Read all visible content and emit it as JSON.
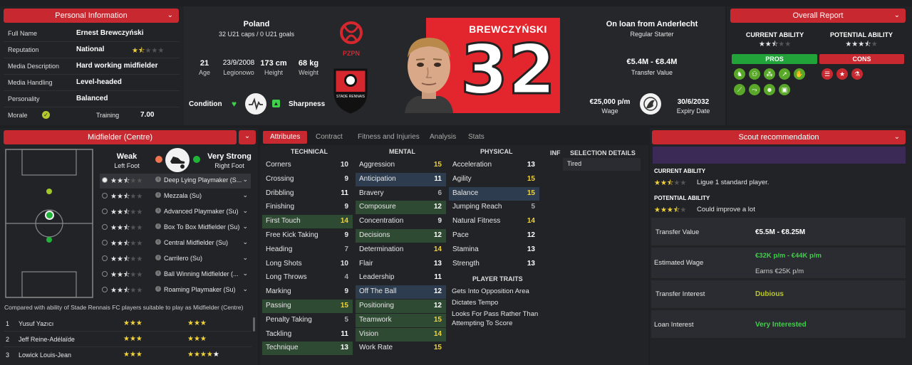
{
  "personal": {
    "header": "Personal Information",
    "rows": [
      {
        "label": "Full Name",
        "value": "Ernest Brewczyński"
      },
      {
        "label": "Reputation",
        "value": "National"
      },
      {
        "label": "Media Description",
        "value": "Hard working midfielder"
      },
      {
        "label": "Media Handling",
        "value": "Level-headed"
      },
      {
        "label": "Personality",
        "value": "Balanced"
      }
    ],
    "morale_label": "Morale",
    "training_label": "Training",
    "training_value": "7.00"
  },
  "profile": {
    "nation": "Poland",
    "caps": "32 U21 caps / 0 U21 goals",
    "age": "21",
    "age_label": "Age",
    "dob": "23/9/2008",
    "dob_label": "Legionowo",
    "height": "173 cm",
    "height_label": "Height",
    "weight": "68 kg",
    "weight_label": "Weight",
    "condition_label": "Condition",
    "sharpness_label": "Sharpness",
    "nation_badge_text": "PZPN",
    "club_badge_text": "STADE RENNAIS",
    "shirt_name": "BREWCZYŃSKI",
    "shirt_number": "32"
  },
  "contract": {
    "loan": "On loan from Anderlecht",
    "status": "Regular Starter",
    "value": "€5.4M - €8.4M",
    "value_label": "Transfer Value",
    "wage": "€25,000 p/m",
    "wage_label": "Wage",
    "expiry": "30/6/2032",
    "expiry_label": "Expiry Date"
  },
  "overall": {
    "header": "Overall Report",
    "current_label": "CURRENT ABILITY",
    "potential_label": "POTENTIAL ABILITY",
    "current_stars": 2.5,
    "potential_stars": 3.5,
    "pros_label": "PROS",
    "cons_label": "CONS"
  },
  "position": {
    "header": "Midfielder (Centre)",
    "weak_label": "Weak",
    "weak_foot": "Left Foot",
    "strong_label": "Very Strong",
    "strong_foot": "Right Foot",
    "roles": [
      {
        "name": "Deep Lying Playmaker (S...",
        "stars": 2.5
      },
      {
        "name": "Mezzala (Su)",
        "stars": 2.5
      },
      {
        "name": "Advanced Playmaker (Su)",
        "stars": 2.5
      },
      {
        "name": "Box To Box Midfielder (Su)",
        "stars": 2.5
      },
      {
        "name": "Central Midfielder (Su)",
        "stars": 2.5
      },
      {
        "name": "Carrilero (Su)",
        "stars": 2.5
      },
      {
        "name": "Ball Winning Midfielder (...",
        "stars": 2.5
      },
      {
        "name": "Roaming Playmaker (Su)",
        "stars": 2.5
      }
    ],
    "compare_text": "Compared with ability of Stade Rennais FC players suitable to play as Midfielder (Centre)",
    "compare": [
      {
        "rank": "1",
        "name": "Yusuf Yazıcı"
      },
      {
        "rank": "2",
        "name": "Jeff Reine-Adélaïde"
      },
      {
        "rank": "3",
        "name": "Lowick Louis-Jean"
      }
    ]
  },
  "tabs": [
    "Attributes",
    "Contract",
    "Fitness and Injuries",
    "Analysis",
    "Stats"
  ],
  "attributes": {
    "technical_label": "TECHNICAL",
    "mental_label": "MENTAL",
    "physical_label": "PHYSICAL",
    "inf_label": "INF",
    "selection_label": "SELECTION DETAILS",
    "selection_value": "Tired",
    "traits_label": "PLAYER TRAITS",
    "technical": [
      {
        "name": "Corners",
        "value": "10"
      },
      {
        "name": "Crossing",
        "value": "9"
      },
      {
        "name": "Dribbling",
        "value": "11"
      },
      {
        "name": "Finishing",
        "value": "9"
      },
      {
        "name": "First Touch",
        "value": "14"
      },
      {
        "name": "Free Kick Taking",
        "value": "9"
      },
      {
        "name": "Heading",
        "value": "7"
      },
      {
        "name": "Long Shots",
        "value": "10"
      },
      {
        "name": "Long Throws",
        "value": "4"
      },
      {
        "name": "Marking",
        "value": "9"
      },
      {
        "name": "Passing",
        "value": "15"
      },
      {
        "name": "Penalty Taking",
        "value": "5"
      },
      {
        "name": "Tackling",
        "value": "11"
      },
      {
        "name": "Technique",
        "value": "13"
      }
    ],
    "mental": [
      {
        "name": "Aggression",
        "value": "15"
      },
      {
        "name": "Anticipation",
        "value": "11"
      },
      {
        "name": "Bravery",
        "value": "6"
      },
      {
        "name": "Composure",
        "value": "12"
      },
      {
        "name": "Concentration",
        "value": "9"
      },
      {
        "name": "Decisions",
        "value": "12"
      },
      {
        "name": "Determination",
        "value": "14"
      },
      {
        "name": "Flair",
        "value": "13"
      },
      {
        "name": "Leadership",
        "value": "11"
      },
      {
        "name": "Off The Ball",
        "value": "12"
      },
      {
        "name": "Positioning",
        "value": "12"
      },
      {
        "name": "Teamwork",
        "value": "15"
      },
      {
        "name": "Vision",
        "value": "14"
      },
      {
        "name": "Work Rate",
        "value": "15"
      }
    ],
    "physical": [
      {
        "name": "Acceleration",
        "value": "13"
      },
      {
        "name": "Agility",
        "value": "15"
      },
      {
        "name": "Balance",
        "value": "15"
      },
      {
        "name": "Jumping Reach",
        "value": "5"
      },
      {
        "name": "Natural Fitness",
        "value": "14"
      },
      {
        "name": "Pace",
        "value": "12"
      },
      {
        "name": "Stamina",
        "value": "13"
      },
      {
        "name": "Strength",
        "value": "13"
      }
    ],
    "traits": [
      "Gets Into Opposition Area",
      "Dictates Tempo",
      "Looks For Pass Rather Than",
      "Attempting To Score"
    ]
  },
  "scout": {
    "header": "Scout recommendation",
    "current_label": "CURRENT ABILITY",
    "current_text": "Ligue 1 standard player.",
    "potential_label": "POTENTIAL ABILITY",
    "potential_text": "Could improve a lot",
    "rows": [
      {
        "label": "Transfer Value",
        "value": "€5.5M - €8.25M"
      },
      {
        "label": "Estimated Wage",
        "value": "€32K p/m - €44K p/m",
        "sub": "Earns €25K p/m"
      },
      {
        "label": "Transfer Interest",
        "value": "Dubious"
      },
      {
        "label": "Loan Interest",
        "value": "Very Interested"
      }
    ]
  },
  "colors": {
    "accent": "#c8282f",
    "good": "#3fcf4a",
    "high": "#f2d33a"
  }
}
